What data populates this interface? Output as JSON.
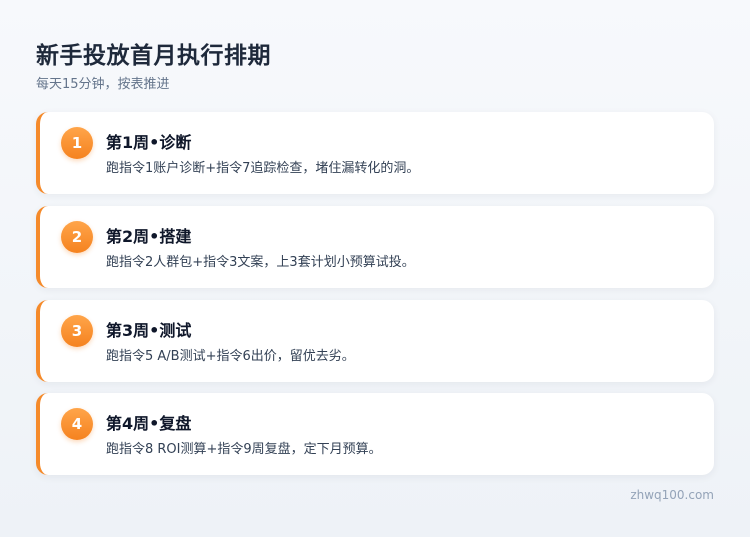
{
  "header": {
    "title": "新手投放首月执行排期",
    "subtitle": "每天15分钟，按表推进"
  },
  "weeks": [
    {
      "number": "1",
      "title": "第1周•诊断",
      "description": "跑指令1账户诊断+指令7追踪检查，堵住漏转化的洞。"
    },
    {
      "number": "2",
      "title": "第2周•搭建",
      "description": "跑指令2人群包+指令3文案，上3套计划小预算试投。"
    },
    {
      "number": "3",
      "title": "第3周•测试",
      "description": "跑指令5 A/B测试+指令6出价，留优去劣。"
    },
    {
      "number": "4",
      "title": "第4周•复盘",
      "description": "跑指令8 ROI测算+指令9周复盘，定下月预算。"
    }
  ],
  "footer": {
    "site": "zhwq100.com"
  },
  "colors": {
    "accent": "#f58a2a",
    "title": "#1e293b",
    "muted": "#64748b"
  }
}
